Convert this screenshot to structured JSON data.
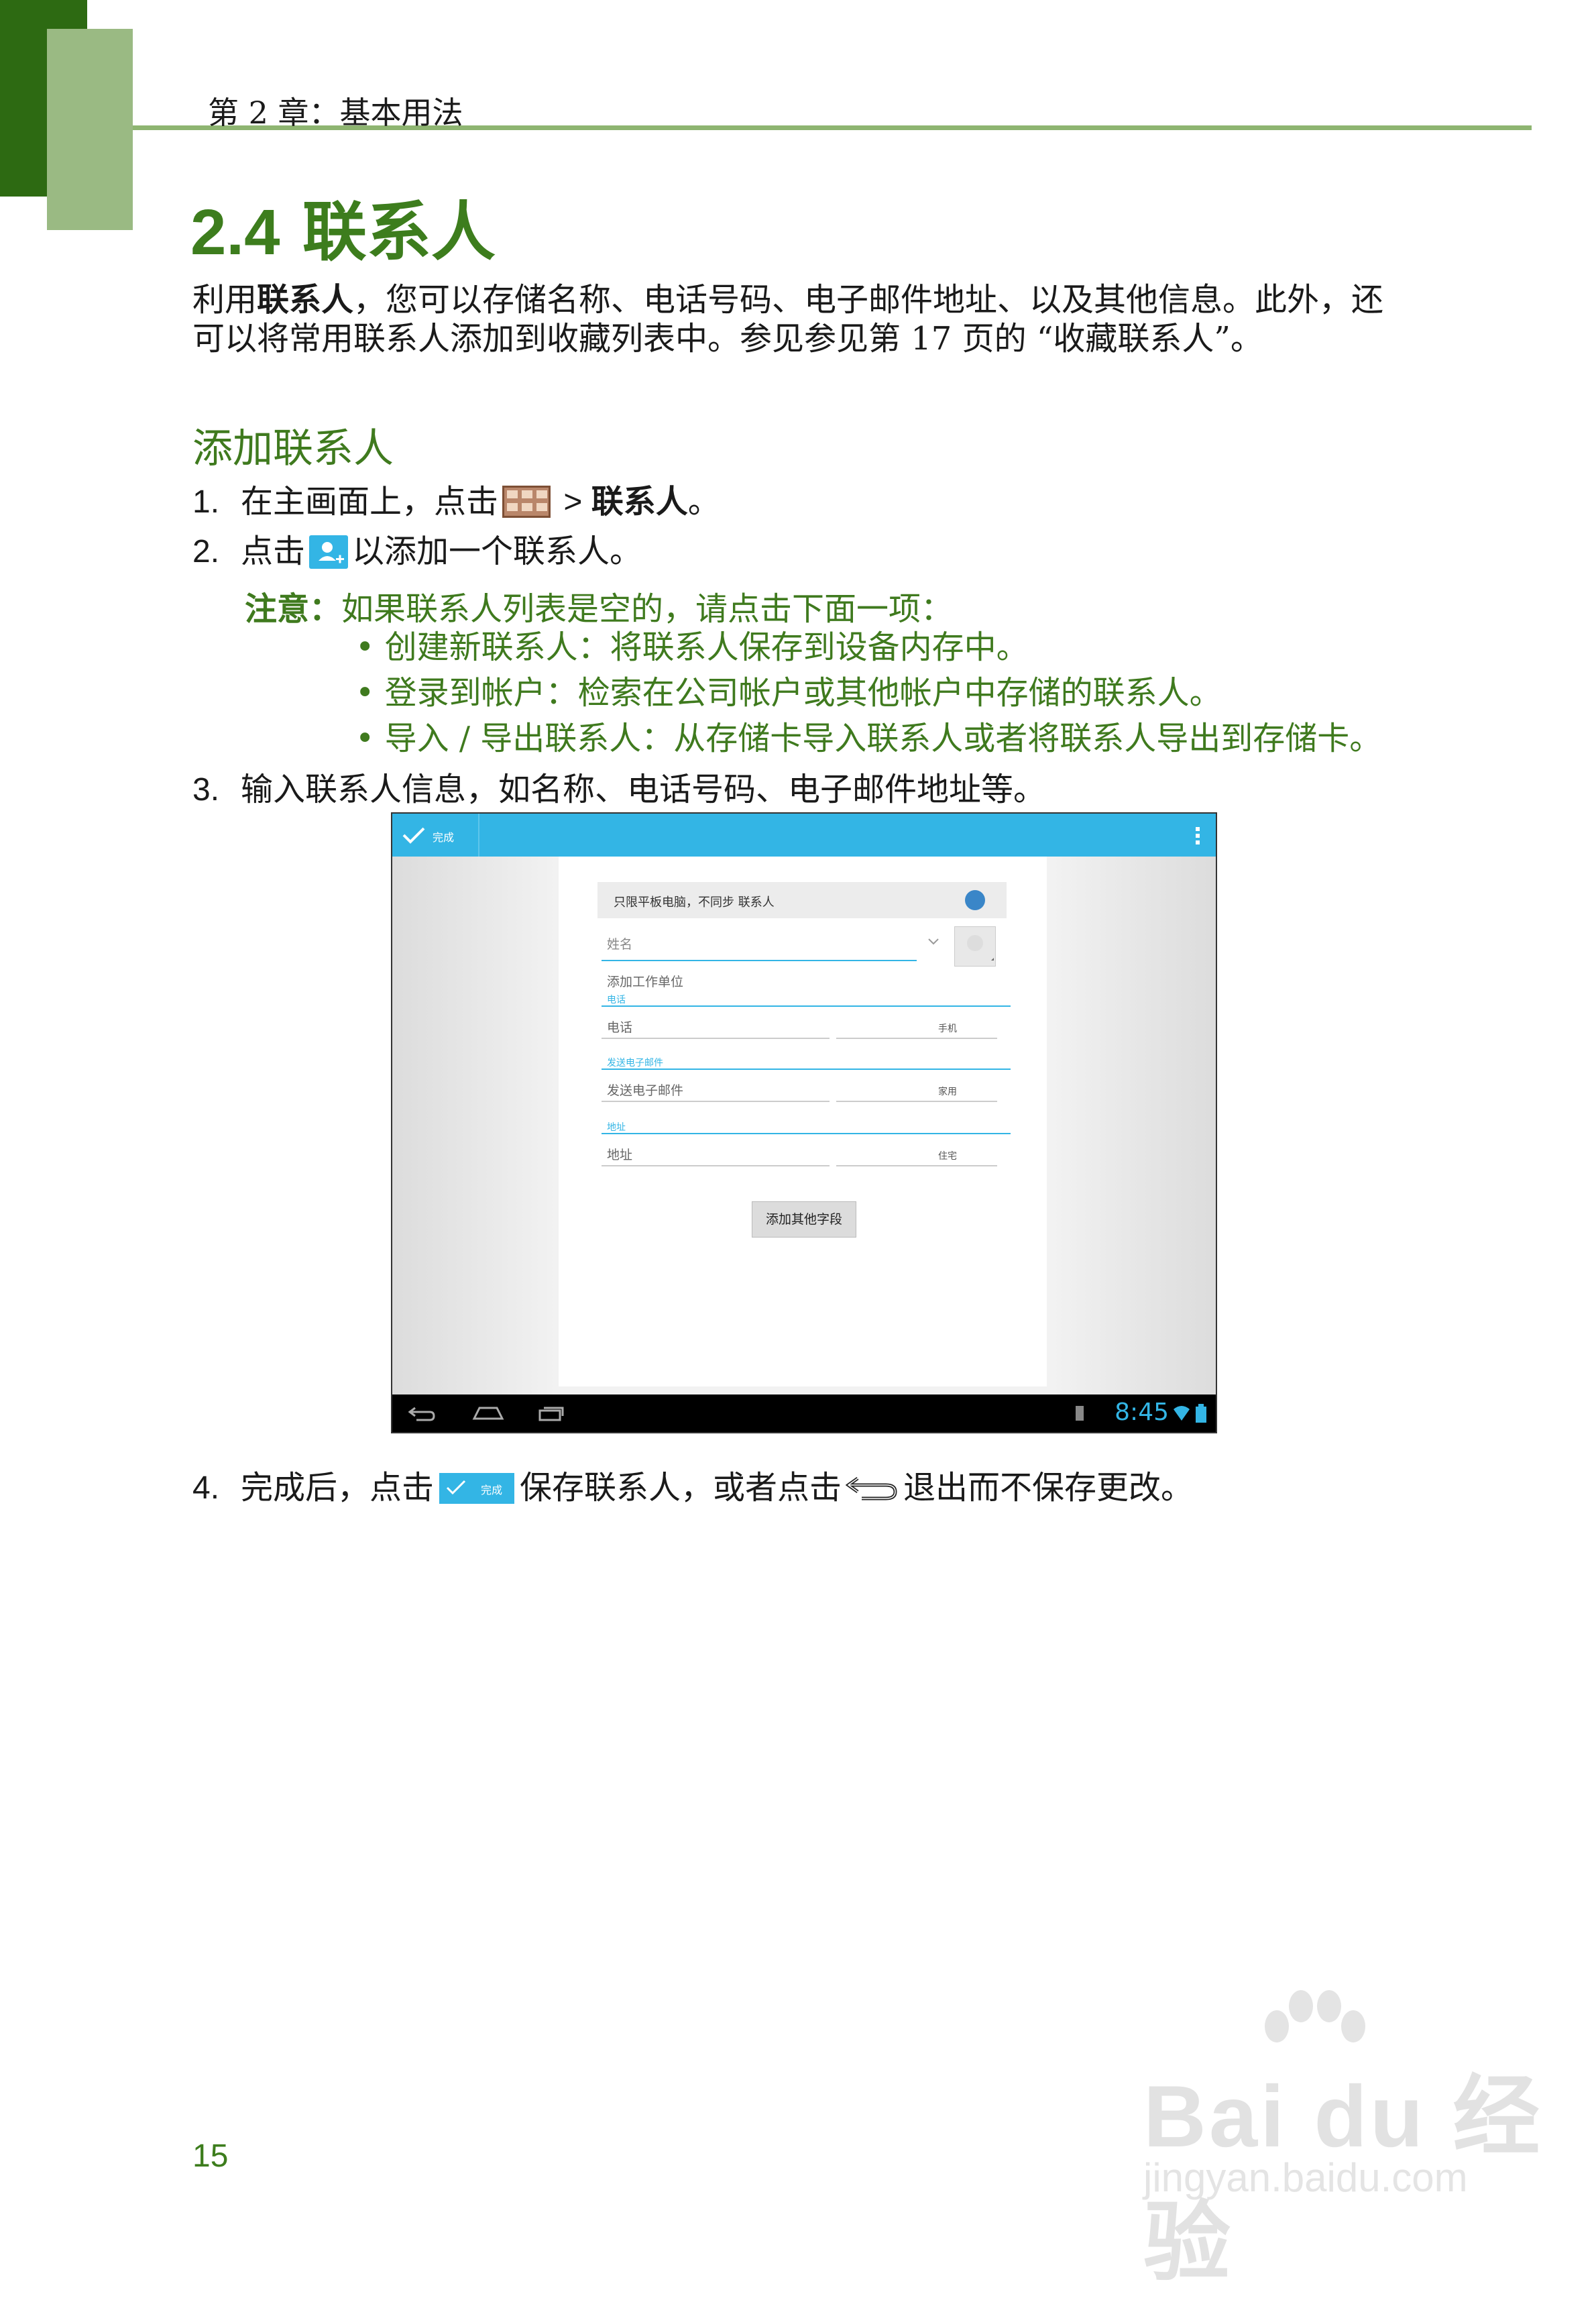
{
  "header": {
    "chapter": "第 2 章：基本用法"
  },
  "section": {
    "number": "2.4",
    "title": "联系人"
  },
  "intro": {
    "prefix": "利用",
    "bold": "联系人",
    "rest": "，您可以存储名称、电话号码、电子邮件地址、以及其他信息。此外，还可以将常用联系人添加到收藏列表中。参见参见第 17 页的 “收藏联系人”。"
  },
  "subsection": {
    "title": "添加联系人"
  },
  "steps": [
    {
      "num": "1.",
      "text_a": "在主画面上，点击",
      "text_b": " > ",
      "bold": "联系人",
      "text_c": "。"
    },
    {
      "num": "2.",
      "text_a": "点击",
      "text_b": "以添加一个联系人。"
    },
    {
      "num": "3.",
      "text_a": "输入联系人信息，如名称、电话号码、电子邮件地址等。"
    },
    {
      "num": "4.",
      "text_a": "完成后，点击",
      "text_b": "保存联系人，或者点击",
      "text_c": "退出而不保存更改。"
    }
  ],
  "note": {
    "label": "注意：",
    "text": "如果联系人列表是空的，请点击下面一项：",
    "bullets": [
      {
        "bold": "创建新联系人",
        "text": "：将联系人保存到设备内存中。"
      },
      {
        "bold": "登录到帐户",
        "text": "：检索在公司帐户或其他帐户中存储的联系人。"
      },
      {
        "bold": "导入 / 导出联系人",
        "text": "：从存储卡导入联系人或者将联系人导出到存储卡。"
      }
    ]
  },
  "screenshot": {
    "done_label": "完成",
    "account_label": "只限平板电脑，不同步 联系人",
    "name_placeholder": "姓名",
    "add_org": "添加工作单位",
    "phone_section": "电话",
    "phone_placeholder": "电话",
    "phone_type": "手机",
    "email_section": "发送电子邮件",
    "email_placeholder": "发送电子邮件",
    "email_type": "家用",
    "address_section": "地址",
    "address_placeholder": "地址",
    "address_type": "住宅",
    "add_field_button": "添加其他字段",
    "clock": "8:45"
  },
  "inline_icons": {
    "done_icon_label": "完成"
  },
  "page_number": "15",
  "watermark": {
    "brand": "Bai du 经验",
    "url": "jingyan.baidu.com"
  },
  "colors": {
    "title_green": "#3d7d1d",
    "accent_blue": "#33b5e5",
    "header_dark": "#2d6a12",
    "header_light": "#9aba83"
  }
}
